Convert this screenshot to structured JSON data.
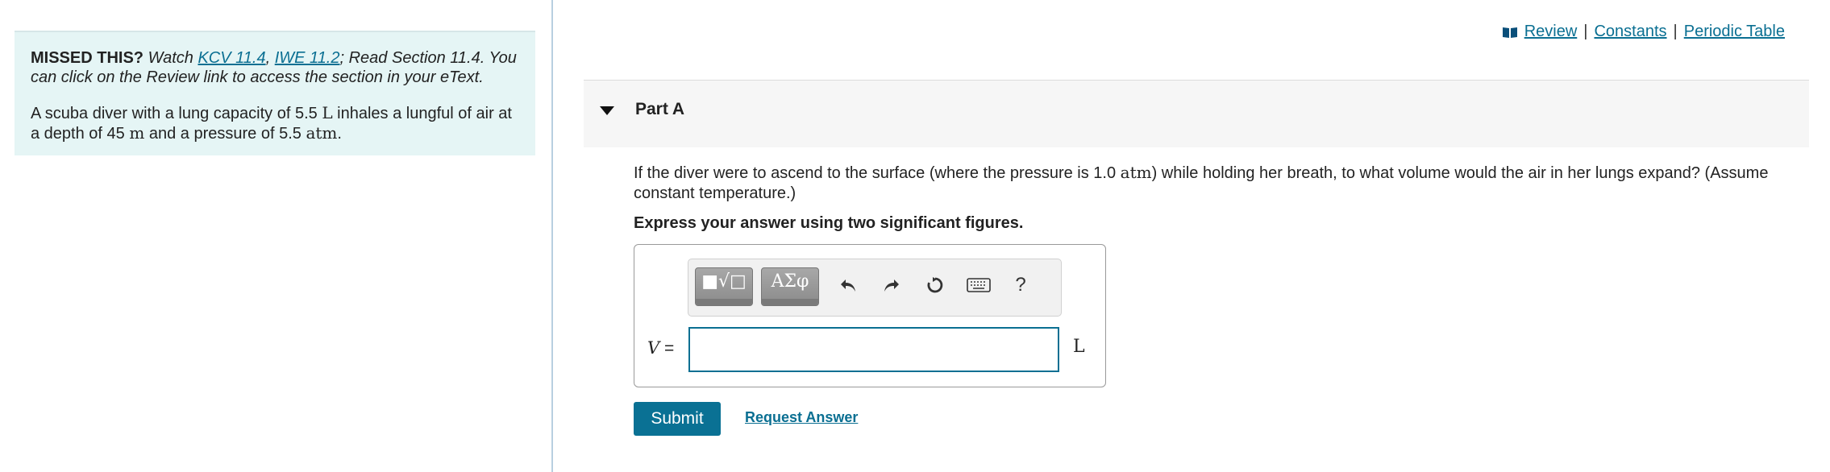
{
  "hint": {
    "missed_label": "MISSED THIS?",
    "watch_text": "Watch",
    "link_kcv": "KCV 11.4",
    "comma": ",",
    "link_iwe": "IWE 11.2",
    "read_text": "; Read Section 11.4. You can click on the Review link to access the section in your eText."
  },
  "problem": {
    "text_1": "A scuba diver with a lung capacity of 5.5",
    "unit_L": "L",
    "text_2": "inhales a lungful of air at a depth of 45",
    "unit_m": "m",
    "text_3": "and a pressure of 5.5",
    "unit_atm": "atm",
    "text_4": "."
  },
  "topbar": {
    "review": "Review",
    "sep1": "|",
    "constants": "Constants",
    "sep2": "|",
    "periodic_table": "Periodic Table",
    "icon": "book-icon"
  },
  "part": {
    "title": "Part A",
    "question_1": "If the diver were to ascend to the surface (where the pressure is 1.0",
    "question_unit": "atm",
    "question_2": ") while holding her breath, to what volume would the air in her lungs expand? (Assume constant temperature.)",
    "instruction": "Express your answer using two significant figures."
  },
  "toolbar": {
    "templates_label": "■√□",
    "symbols_label": "ΑΣφ",
    "undo_icon": "undo-icon",
    "redo_icon": "redo-icon",
    "reset_icon": "reset-icon",
    "keyboard_icon": "keyboard-icon",
    "help_label": "?"
  },
  "answer": {
    "variable": "V",
    "equals": "=",
    "value": "",
    "unit": "L"
  },
  "actions": {
    "submit": "Submit",
    "request_answer": "Request Answer"
  },
  "colors": {
    "accent": "#0a6f92",
    "hint_bg": "#e5f5f5",
    "submit_bg": "#0a7194"
  }
}
